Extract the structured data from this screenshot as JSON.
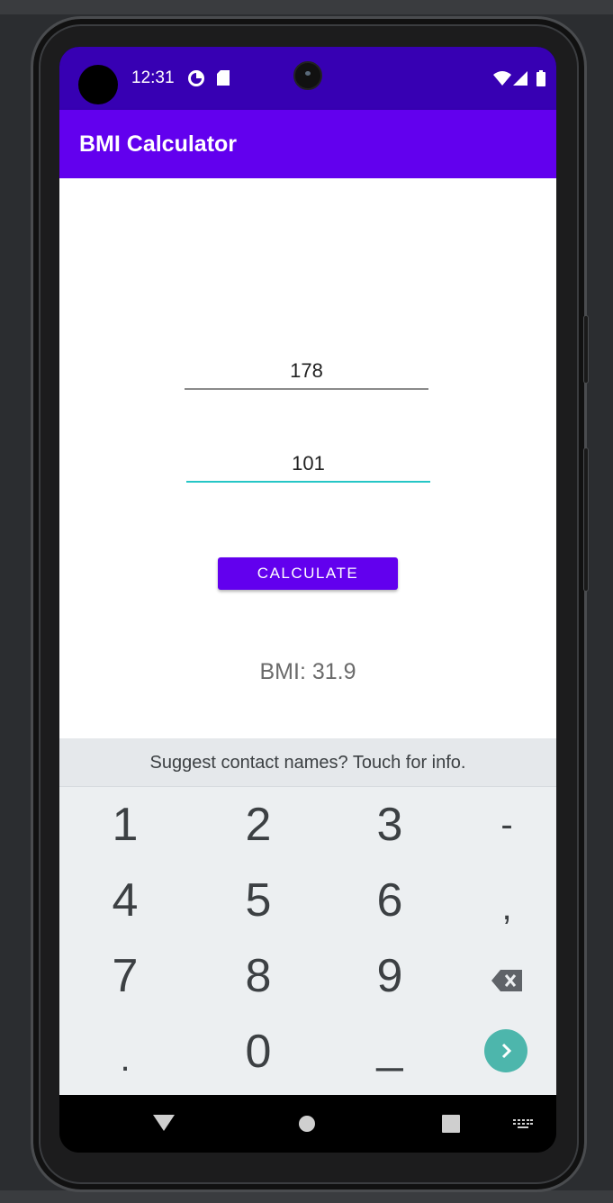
{
  "status_bar": {
    "time": "12:31",
    "left_icons": [
      "data-saver-icon",
      "sd-card-icon"
    ],
    "right_icons": [
      "wifi-icon",
      "signal-icon",
      "battery-icon"
    ]
  },
  "app_bar": {
    "title": "BMI Calculator"
  },
  "form": {
    "height_value": "178",
    "weight_value": "101",
    "calculate_label": "CALCULATE",
    "result_text": "BMI: 31.9"
  },
  "keyboard": {
    "suggestion": "Suggest contact names? Touch for info.",
    "rows": [
      [
        "1",
        "2",
        "3",
        "-"
      ],
      [
        "4",
        "5",
        "6",
        ","
      ],
      [
        "7",
        "8",
        "9",
        "⌫"
      ],
      [
        ".",
        "0",
        "_",
        "›"
      ]
    ]
  },
  "colors": {
    "status_bar": "#3700b3",
    "primary": "#6200ee",
    "accent_underline": "#26c6c6",
    "go_button": "#4db6ac"
  },
  "nav_bar": {
    "icons": [
      "back-icon",
      "home-icon",
      "recents-icon",
      "keyboard-switch-icon"
    ]
  }
}
